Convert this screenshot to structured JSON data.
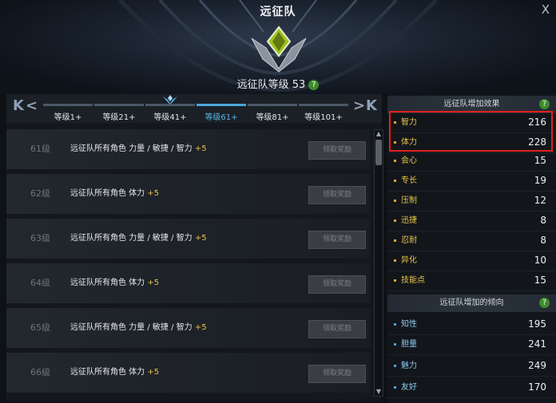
{
  "window": {
    "title": "远征队",
    "close_label": "X"
  },
  "header": {
    "level_label": "远征队等级 53",
    "help": "?"
  },
  "tabs": {
    "prev": "K",
    "prev2": "<",
    "next": ">",
    "next2": "K",
    "items": [
      {
        "label": "等级1+"
      },
      {
        "label": "等级21+"
      },
      {
        "label": "等级41+"
      },
      {
        "label": "等级61+"
      },
      {
        "label": "等级81+"
      },
      {
        "label": "等级101+"
      }
    ],
    "active_index": 3
  },
  "rewards": [
    {
      "level": "61级",
      "desc": "远征队所有角色 力量 / 敏捷 / 智力",
      "bonus": "+5",
      "button": "领取奖励"
    },
    {
      "level": "62级",
      "desc": "远征队所有角色 体力",
      "bonus": "+5",
      "button": "领取奖励"
    },
    {
      "level": "63级",
      "desc": "远征队所有角色 力量 / 敏捷 / 智力",
      "bonus": "+5",
      "button": "领取奖励"
    },
    {
      "level": "64级",
      "desc": "远征队所有角色 体力",
      "bonus": "+5",
      "button": "领取奖励"
    },
    {
      "level": "65级",
      "desc": "远征队所有角色 力量 / 敏捷 / 智力",
      "bonus": "+5",
      "button": "领取奖励"
    },
    {
      "level": "66级",
      "desc": "远征队所有角色 体力",
      "bonus": "+5",
      "button": "领取奖励"
    }
  ],
  "scrollbar": {
    "up": "▲",
    "down": "▼"
  },
  "effects": {
    "title": "远征队增加效果",
    "help": "?",
    "stats": [
      {
        "name": "智力",
        "value": "216"
      },
      {
        "name": "体力",
        "value": "228"
      },
      {
        "name": "会心",
        "value": "15"
      },
      {
        "name": "专长",
        "value": "19"
      },
      {
        "name": "压制",
        "value": "12"
      },
      {
        "name": "迅捷",
        "value": "8"
      },
      {
        "name": "忍耐",
        "value": "8"
      },
      {
        "name": "异化",
        "value": "10"
      },
      {
        "name": "技能点",
        "value": "15"
      }
    ]
  },
  "tendency": {
    "title": "远征队增加的倾向",
    "help": "?",
    "stats": [
      {
        "name": "知性",
        "value": "195"
      },
      {
        "name": "胆量",
        "value": "241"
      },
      {
        "name": "魅力",
        "value": "249"
      },
      {
        "name": "友好",
        "value": "170"
      }
    ]
  },
  "colors": {
    "accent": "#4aa6d8",
    "bonus": "#e8c24a",
    "highlight": "#e0211d"
  }
}
